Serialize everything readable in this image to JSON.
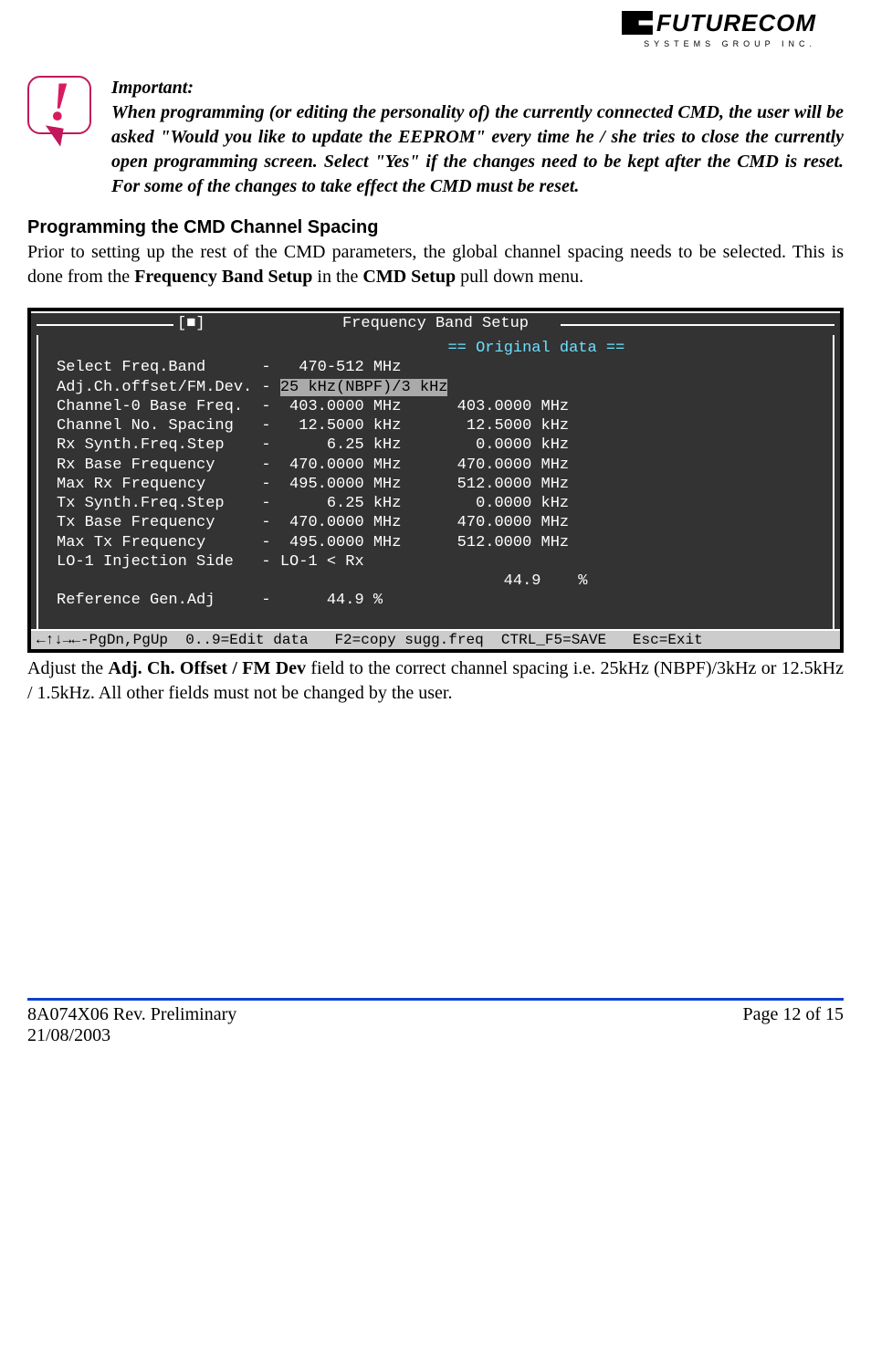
{
  "logo": {
    "main": "FUTURECOM",
    "sub": "SYSTEMS GROUP INC."
  },
  "important": {
    "heading": "Important:",
    "body": "When programming (or editing the personality of) the currently connected CMD, the user will be asked \"Would you like to update the EEPROM\" every time he / she tries to close the currently open programming screen. Select \"Yes\" if the changes need to be kept after the CMD is reset. For some of the changes to take effect the CMD must be reset."
  },
  "section": {
    "heading": "Programming the CMD Channel Spacing",
    "intro_pre": "Prior to setting up the rest of the CMD parameters, the global channel spacing needs to be selected. This is done from the ",
    "intro_b1": "Frequency Band Setup",
    "intro_mid": " in the ",
    "intro_b2": "CMD Setup",
    "intro_post": " pull down menu."
  },
  "terminal": {
    "close_marker": "[■]",
    "title": "Frequency Band Setup",
    "orig_header": "== Original data ==",
    "rows": [
      {
        "label": "Select Freq.Band",
        "val1": "470-512",
        "unit1": "MHz",
        "val2": ""
      },
      {
        "label": "Adj.Ch.offset/FM.Dev.",
        "val1": "25 kHz(NBPF)/3 kHz",
        "hl": true
      },
      {
        "label": "Channel-0 Base Freq.",
        "val1": "403.0000",
        "unit1": "MHz",
        "val2": "403.0000",
        "unit2": "MHz"
      },
      {
        "label": "Channel No. Spacing",
        "val1": "12.5000",
        "unit1": "kHz",
        "val2": "12.5000",
        "unit2": "kHz"
      },
      {
        "label": "Rx Synth.Freq.Step",
        "val1": "6.25",
        "unit1": "kHz",
        "val2": "0.0000",
        "unit2": "kHz"
      },
      {
        "label": "Rx Base Frequency",
        "val1": "470.0000",
        "unit1": "MHz",
        "val2": "470.0000",
        "unit2": "MHz"
      },
      {
        "label": "Max Rx Frequency",
        "val1": "495.0000",
        "unit1": "MHz",
        "val2": "512.0000",
        "unit2": "MHz"
      },
      {
        "label": "Tx Synth.Freq.Step",
        "val1": "6.25",
        "unit1": "kHz",
        "val2": "0.0000",
        "unit2": "kHz"
      },
      {
        "label": "Tx Base Frequency",
        "val1": "470.0000",
        "unit1": "MHz",
        "val2": "470.0000",
        "unit2": "MHz"
      },
      {
        "label": "Max Tx Frequency",
        "val1": "495.0000",
        "unit1": "MHz",
        "val2": "512.0000",
        "unit2": "MHz"
      },
      {
        "label": "LO-1 Injection Side",
        "val1": "LO-1 < Rx"
      },
      {
        "label": "",
        "val2": "44.9",
        "unit2": "%"
      },
      {
        "label": "Reference Gen.Adj",
        "val1": "44.9",
        "unit1": "%"
      }
    ],
    "footer": "←↑↓→←-PgDn,PgUp  0..9=Edit data   F2=copy sugg.freq  CTRL_F5=SAVE   Esc=Exit"
  },
  "after_terminal": {
    "pre": "Adjust the ",
    "b": "Adj. Ch. Offset / FM Dev",
    "post": " field to the correct channel spacing i.e. 25kHz (NBPF)/3kHz or 12.5kHz / 1.5kHz. All other fields must not be changed by the user."
  },
  "footer": {
    "left1": "8A074X06 Rev. Preliminary",
    "left2": "21/08/2003",
    "right": "Page 12 of 15"
  }
}
